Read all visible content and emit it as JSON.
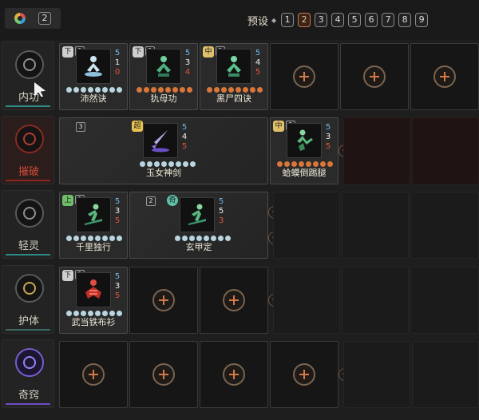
{
  "topbar": {
    "left_badge": "2",
    "preset_label": "预设",
    "preset_separator": "◆",
    "presets": [
      "1",
      "2",
      "3",
      "4",
      "5",
      "6",
      "7",
      "8",
      "9"
    ],
    "active_preset": "2"
  },
  "rows": [
    {
      "label": "内功",
      "emblem_color": "#8f8f8f"
    },
    {
      "label": "摧破",
      "emblem_color": "#b13a2e"
    },
    {
      "label": "轻灵",
      "emblem_color": "#8f8f8f"
    },
    {
      "label": "护体",
      "emblem_color": "#c6a850"
    },
    {
      "label": "奇窍",
      "emblem_color": "#9a80f0"
    }
  ],
  "skills": {
    "peiranjue": {
      "name": "沛然诀",
      "tier": "下",
      "rank": "1",
      "stats": [
        "5",
        "1",
        "0"
      ]
    },
    "qiumugong": {
      "name": "犰母功",
      "tier": "下",
      "rank": "1",
      "stats": [
        "5",
        "3",
        "4"
      ]
    },
    "heishisijue": {
      "name": "黑尸四诀",
      "tier": "中",
      "rank": "1",
      "stats": [
        "5",
        "4",
        "5"
      ]
    },
    "yunvshenjian": {
      "name": "玉女神剑",
      "tier": "超",
      "rank": "3",
      "stats": [
        "5",
        "4",
        "5"
      ]
    },
    "hamadaotitui": {
      "name": "蛤蟆倒踢腿",
      "tier": "中",
      "rank": "1",
      "stats": [
        "5",
        "3",
        "5"
      ]
    },
    "qianliduxing": {
      "name": "千里独行",
      "tier": "上",
      "rank": "1",
      "stats": [
        "5",
        "3",
        "5"
      ]
    },
    "xuanjiading": {
      "name": "玄甲定",
      "tier": "奇",
      "rank": "2",
      "stats": [
        "5",
        "5",
        "3"
      ]
    },
    "wudangtiebushan": {
      "name": "武当铁布衫",
      "tier": "下",
      "rank": "1",
      "stats": [
        "5",
        "3",
        "5"
      ]
    }
  },
  "side_buttons": {
    "plus": "+",
    "minus": "−"
  },
  "colors": {
    "accent": "#d47a48",
    "teal": "#2f8a85",
    "red": "#b13a2e",
    "purple": "#7a5cd0"
  }
}
